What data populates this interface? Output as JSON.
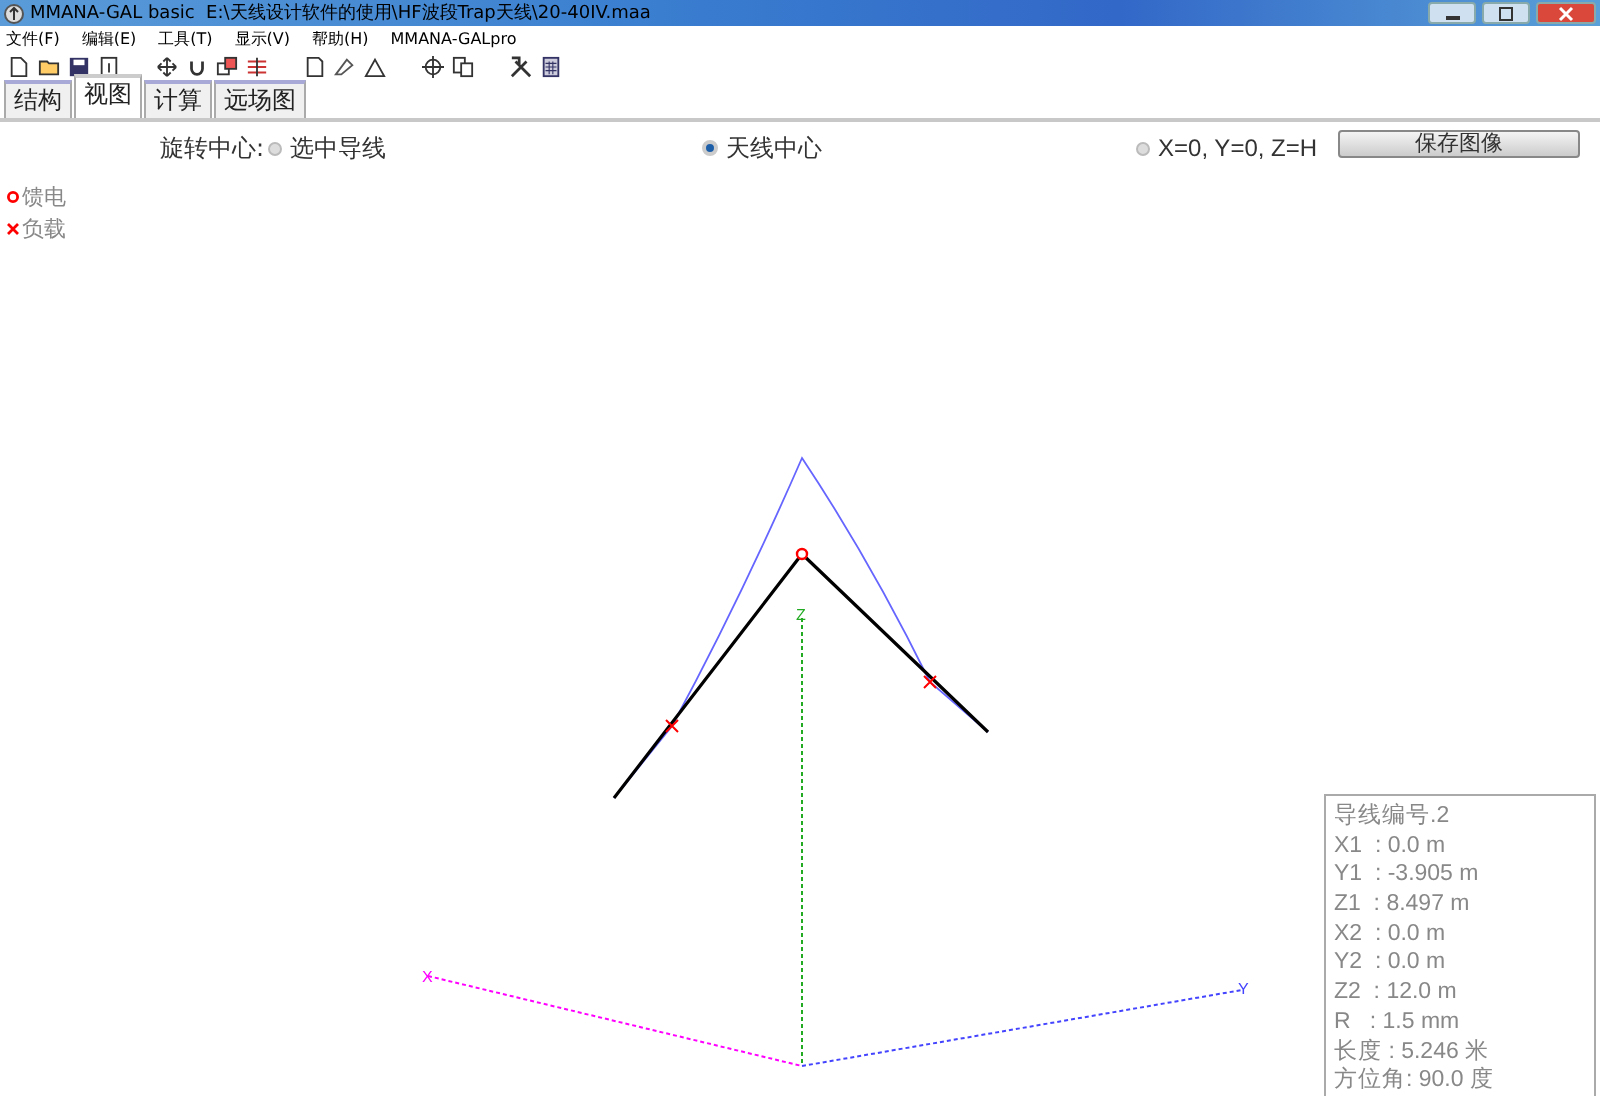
{
  "window": {
    "title": "MMANA-GAL basic  E:\\天线设计软件的使用\\HF波段Trap天线\\20-40IV.maa"
  },
  "menu": [
    "文件(F)",
    "编辑(E)",
    "工具(T)",
    "显示(V)",
    "帮助(H)",
    "MMANA-GALpro"
  ],
  "tabs": [
    {
      "label": "结构",
      "selected": false
    },
    {
      "label": "视图",
      "selected": true
    },
    {
      "label": "计算",
      "selected": false
    },
    {
      "label": "远场图",
      "selected": false
    }
  ],
  "view": {
    "rotation_label": "旋转中心:",
    "rotation_options": [
      {
        "label": "选中导线",
        "selected": false
      },
      {
        "label": "天线中心",
        "selected": true
      },
      {
        "label": "X=0, Y=0, Z=H",
        "selected": false
      }
    ],
    "save_button": "保存图像",
    "legend": [
      {
        "kind": "feed",
        "label": "馈电",
        "color": "#ff0000"
      },
      {
        "kind": "load",
        "label": "负载",
        "color": "#ff0000"
      }
    ],
    "axis_labels": {
      "x": "X",
      "y": "Y",
      "z": "Z"
    },
    "wire_info": [
      "导线编号.2",
      "X1  : 0.0 m",
      "Y1  : -3.905 m",
      "Z1  : 8.497 m",
      "X2  : 0.0 m",
      "Y2  : 0.0 m",
      "Z2  : 12.0 m",
      "R   : 1.5 mm",
      "长度 : 5.246 米",
      "方位角: 90.0 度"
    ]
  }
}
